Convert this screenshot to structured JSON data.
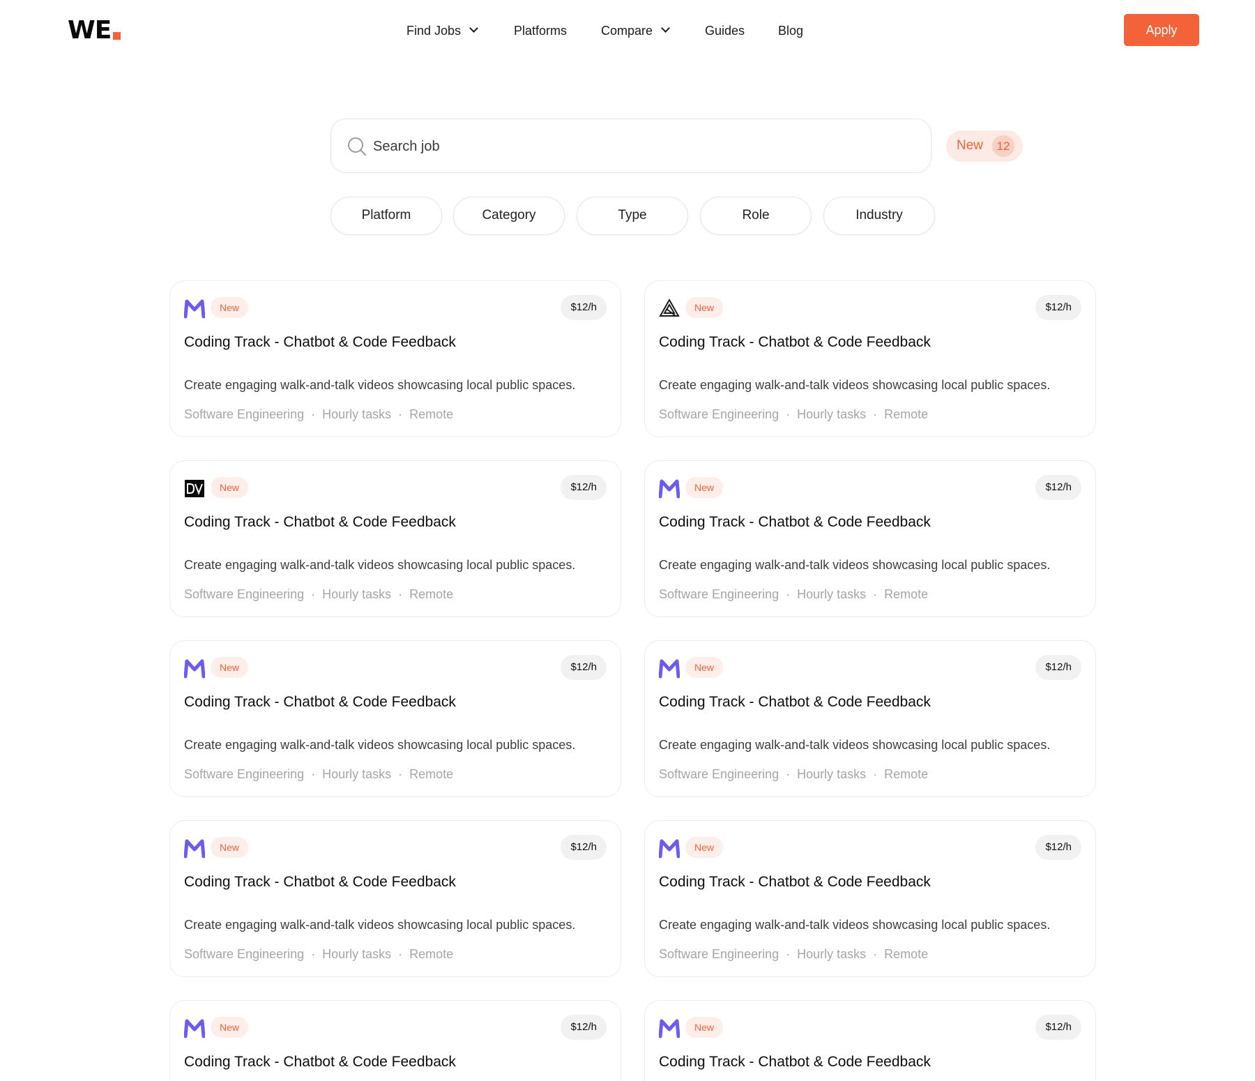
{
  "brand": {
    "logo_text": "WE"
  },
  "nav": {
    "items": [
      {
        "label": "Find Jobs",
        "has_dropdown": true
      },
      {
        "label": "Platforms",
        "has_dropdown": false
      },
      {
        "label": "Compare",
        "has_dropdown": true
      },
      {
        "label": "Guides",
        "has_dropdown": false
      },
      {
        "label": "Blog",
        "has_dropdown": false
      }
    ],
    "apply_label": "Apply"
  },
  "search": {
    "placeholder": "Search job",
    "new_label": "New",
    "new_count": "12"
  },
  "filters": [
    "Platform",
    "Category",
    "Type",
    "Role",
    "Industry"
  ],
  "colors": {
    "accent": "#f4623a",
    "accent_light": "#fdeae4",
    "logo_purple": "#6b5cf0"
  },
  "jobs": [
    {
      "logo": "m-logo-icon",
      "badge": "New",
      "rate": "$12/h",
      "title": "Coding Track - Chatbot & Code Feedback",
      "description": "Create engaging walk-and-talk videos showcasing local public spaces.",
      "tags": [
        "Software Engineering",
        "Hourly tasks",
        "Remote"
      ]
    },
    {
      "logo": "triangle-logo-icon",
      "badge": "New",
      "rate": "$12/h",
      "title": "Coding Track - Chatbot & Code Feedback",
      "description": "Create engaging walk-and-talk videos showcasing local public spaces.",
      "tags": [
        "Software Engineering",
        "Hourly tasks",
        "Remote"
      ]
    },
    {
      "logo": "dv-logo-icon",
      "badge": "New",
      "rate": "$12/h",
      "title": "Coding Track - Chatbot & Code Feedback",
      "description": "Create engaging walk-and-talk videos showcasing local public spaces.",
      "tags": [
        "Software Engineering",
        "Hourly tasks",
        "Remote"
      ]
    },
    {
      "logo": "m-logo-icon",
      "badge": "New",
      "rate": "$12/h",
      "title": "Coding Track - Chatbot & Code Feedback",
      "description": "Create engaging walk-and-talk videos showcasing local public spaces.",
      "tags": [
        "Software Engineering",
        "Hourly tasks",
        "Remote"
      ]
    },
    {
      "logo": "m-logo-icon",
      "badge": "New",
      "rate": "$12/h",
      "title": "Coding Track - Chatbot & Code Feedback",
      "description": "Create engaging walk-and-talk videos showcasing local public spaces.",
      "tags": [
        "Software Engineering",
        "Hourly tasks",
        "Remote"
      ]
    },
    {
      "logo": "m-logo-icon",
      "badge": "New",
      "rate": "$12/h",
      "title": "Coding Track - Chatbot & Code Feedback",
      "description": "Create engaging walk-and-talk videos showcasing local public spaces.",
      "tags": [
        "Software Engineering",
        "Hourly tasks",
        "Remote"
      ]
    },
    {
      "logo": "m-logo-icon",
      "badge": "New",
      "rate": "$12/h",
      "title": "Coding Track - Chatbot & Code Feedback",
      "description": "Create engaging walk-and-talk videos showcasing local public spaces.",
      "tags": [
        "Software Engineering",
        "Hourly tasks",
        "Remote"
      ]
    },
    {
      "logo": "m-logo-icon",
      "badge": "New",
      "rate": "$12/h",
      "title": "Coding Track - Chatbot & Code Feedback",
      "description": "Create engaging walk-and-talk videos showcasing local public spaces.",
      "tags": [
        "Software Engineering",
        "Hourly tasks",
        "Remote"
      ]
    },
    {
      "logo": "m-logo-icon",
      "badge": "New",
      "rate": "$12/h",
      "title": "Coding Track - Chatbot & Code Feedback",
      "description": "",
      "tags": []
    },
    {
      "logo": "m-logo-icon",
      "badge": "New",
      "rate": "$12/h",
      "title": "Coding Track - Chatbot & Code Feedback",
      "description": "",
      "tags": []
    }
  ]
}
